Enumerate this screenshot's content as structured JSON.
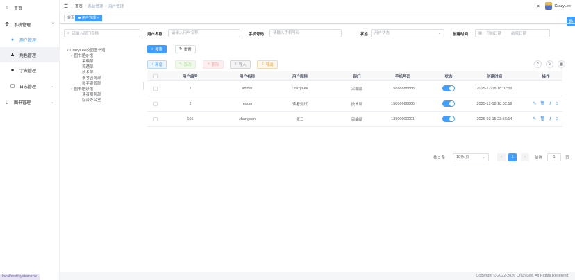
{
  "sidebar": {
    "items": [
      {
        "label": "首页",
        "icon": "home-icon"
      },
      {
        "label": "系统管理",
        "icon": "gear-icon"
      },
      {
        "label": "用户管理",
        "icon": "user-icon"
      },
      {
        "label": "角色管理",
        "icon": "user-group-icon"
      },
      {
        "label": "字典管理",
        "icon": "dict-icon"
      },
      {
        "label": "日志管理",
        "icon": "log-icon"
      },
      {
        "label": "图书管理",
        "icon": "book-icon"
      }
    ],
    "status_url": "localhost/system/role"
  },
  "header": {
    "breadcrumb": [
      "首页",
      "系统管理",
      "用户管理"
    ],
    "username": "CrazyLee"
  },
  "tags": {
    "home": "首页",
    "active": "用户管理 ×"
  },
  "dept": {
    "search_placeholder": "请输入部门名称",
    "tree": [
      "CrazyLee校园图书馆",
      "图书馆办馆",
      "采编部",
      "流通部",
      "技术部",
      "参考咨询部",
      "数字资源部",
      "图书馆分馆",
      "读者服务部",
      "综合办公室"
    ]
  },
  "query": {
    "username_label": "用户名称",
    "username_placeholder": "请输入用户名称",
    "phone_label": "手机号码",
    "phone_placeholder": "请输入手机号码",
    "status_label": "状态",
    "status_placeholder": "用户状态",
    "created_label": "创建时间",
    "start_placeholder": "开始日期",
    "range_sep": "-",
    "end_placeholder": "结束日期",
    "search_btn": "搜索",
    "reset_btn": "重置"
  },
  "toolbar": {
    "add": "新增",
    "edit": "修改",
    "delete": "删除",
    "import": "导入",
    "export": "导出"
  },
  "table": {
    "columns": [
      "用户编号",
      "用户名称",
      "用户昵称",
      "部门",
      "手机号码",
      "状态",
      "创建时间",
      "操作"
    ],
    "rows": [
      {
        "id": "1",
        "username": "admin",
        "nickname": "CrazyLee",
        "dept": "采编部",
        "phone": "15888888888",
        "status": true,
        "created": "2025-12-18 18:02:59",
        "ops": false
      },
      {
        "id": "2",
        "username": "reader",
        "nickname": "读者测试",
        "dept": "技术部",
        "phone": "15866666666",
        "status": true,
        "created": "2025-12-18 18:02:59",
        "ops": true
      },
      {
        "id": "101",
        "username": "zhangsan",
        "nickname": "张三",
        "dept": "采编部",
        "phone": "13800000001",
        "status": true,
        "created": "2026-03-15 23:56:14",
        "ops": true
      }
    ]
  },
  "pagination": {
    "total": "共 3 条",
    "page_size": "10条/页",
    "prev": "<",
    "current": "1",
    "next": ">",
    "goto_label": "前往",
    "goto_value": "1",
    "page_unit": "页"
  },
  "footer": "Copyright © 2022-2026 CrazyLee. All Rights Reserved.",
  "colors": {
    "primary": "#409eff"
  }
}
